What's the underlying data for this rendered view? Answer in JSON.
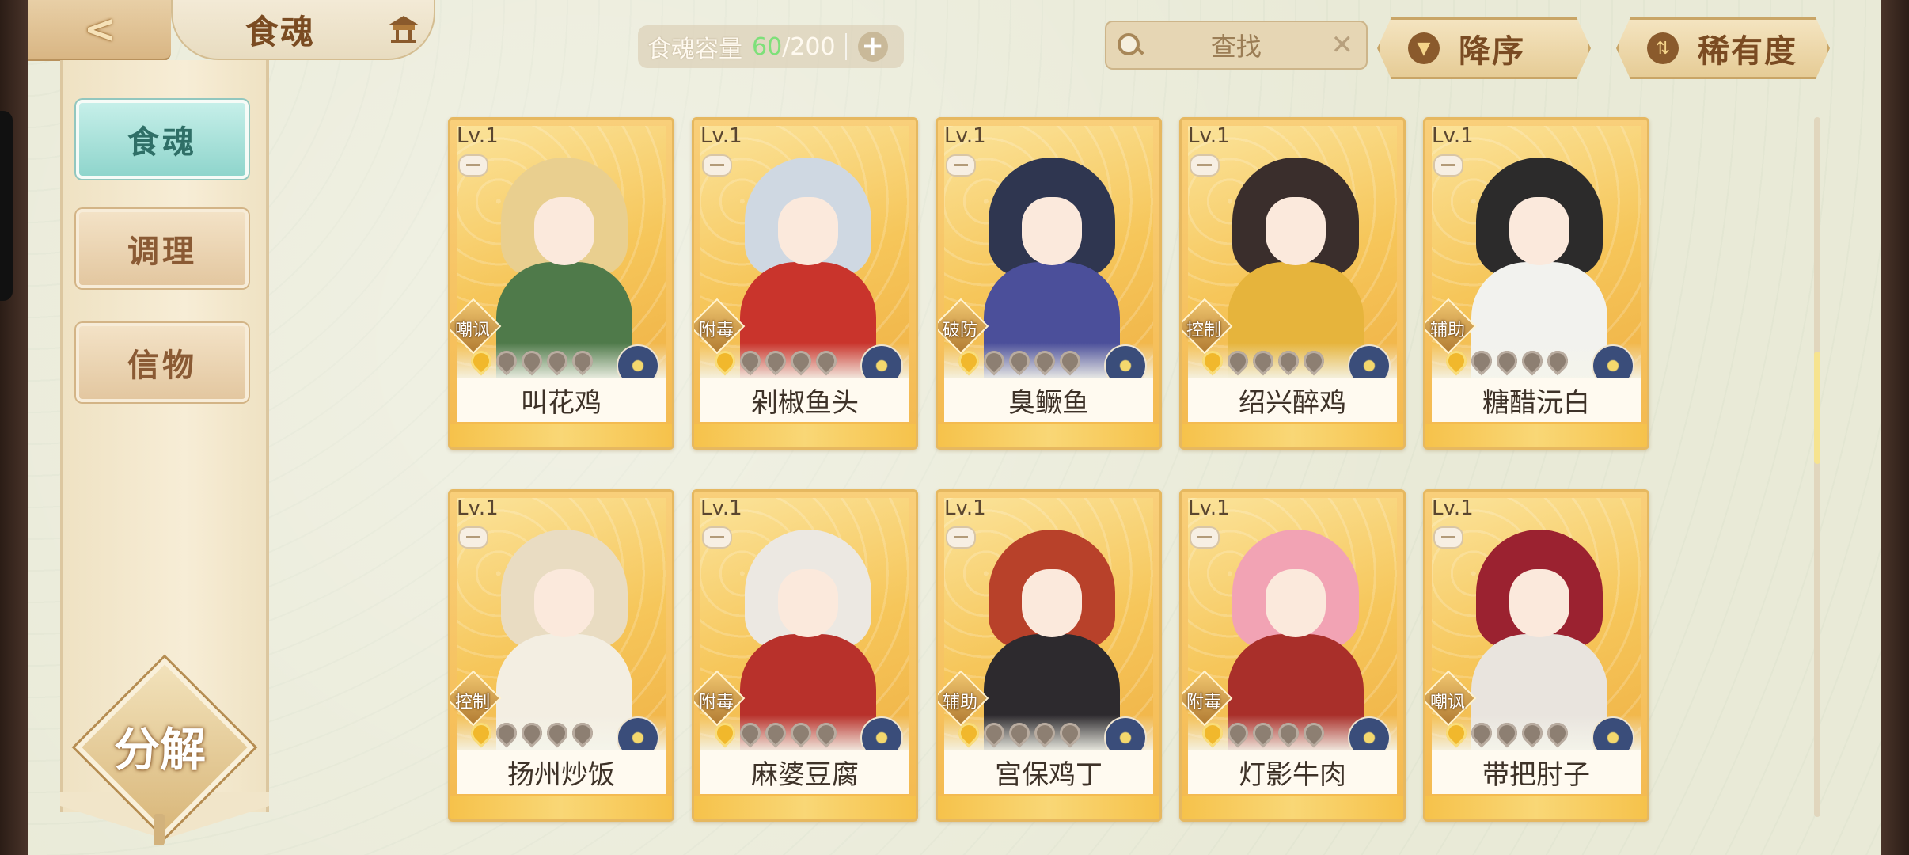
{
  "header": {
    "title": "食魂",
    "capacity": {
      "label": "食魂容量",
      "current": "60",
      "max": "/200"
    },
    "search": {
      "label": "查找",
      "clear": "✕"
    },
    "sort_order": {
      "label": "降序",
      "icon": "▼"
    },
    "sort_key": {
      "label": "稀有度",
      "icon": "⇅"
    }
  },
  "sidebar": {
    "tabs": [
      {
        "label": "食魂",
        "active": true
      },
      {
        "label": "调理",
        "active": false
      },
      {
        "label": "信物",
        "active": false
      }
    ],
    "decompose_label": "分解"
  },
  "cards": [
    {
      "name": "叫花鸡",
      "level": "Lv.1",
      "role": "嘲讽",
      "stars": 1,
      "palette": {
        "hair": "#e9cf8f",
        "body": "#4f7a4a"
      }
    },
    {
      "name": "剁椒鱼头",
      "level": "Lv.1",
      "role": "附毒",
      "stars": 1,
      "palette": {
        "hair": "#cfd8e2",
        "body": "#c9342c"
      }
    },
    {
      "name": "臭鳜鱼",
      "level": "Lv.1",
      "role": "破防",
      "stars": 1,
      "palette": {
        "hair": "#2f3650",
        "body": "#4b4f9a"
      }
    },
    {
      "name": "绍兴醉鸡",
      "level": "Lv.1",
      "role": "控制",
      "stars": 1,
      "palette": {
        "hair": "#3a2e2c",
        "body": "#e6b43c"
      }
    },
    {
      "name": "糖醋沅白",
      "level": "Lv.1",
      "role": "辅助",
      "stars": 1,
      "palette": {
        "hair": "#2c2b2b",
        "body": "#f2f2ee"
      }
    },
    {
      "name": "扬州炒饭",
      "level": "Lv.1",
      "role": "控制",
      "stars": 1,
      "palette": {
        "hair": "#e9dcc2",
        "body": "#f3eee2"
      }
    },
    {
      "name": "麻婆豆腐",
      "level": "Lv.1",
      "role": "附毒",
      "stars": 1,
      "palette": {
        "hair": "#ece8e2",
        "body": "#b8312b"
      }
    },
    {
      "name": "宫保鸡丁",
      "level": "Lv.1",
      "role": "辅助",
      "stars": 1,
      "palette": {
        "hair": "#b8412a",
        "body": "#2d2a2e"
      }
    },
    {
      "name": "灯影牛肉",
      "level": "Lv.1",
      "role": "附毒",
      "stars": 1,
      "palette": {
        "hair": "#f2a3b4",
        "body": "#a92f2a"
      }
    },
    {
      "name": "带把肘子",
      "level": "Lv.1",
      "role": "嘲讽",
      "stars": 1,
      "palette": {
        "hair": "#9b2230",
        "body": "#e9e4de"
      }
    }
  ],
  "colors": {
    "accent": "#7ee07a",
    "card_gold": "#f4b94e",
    "active_tab": "#8fd5cc"
  }
}
